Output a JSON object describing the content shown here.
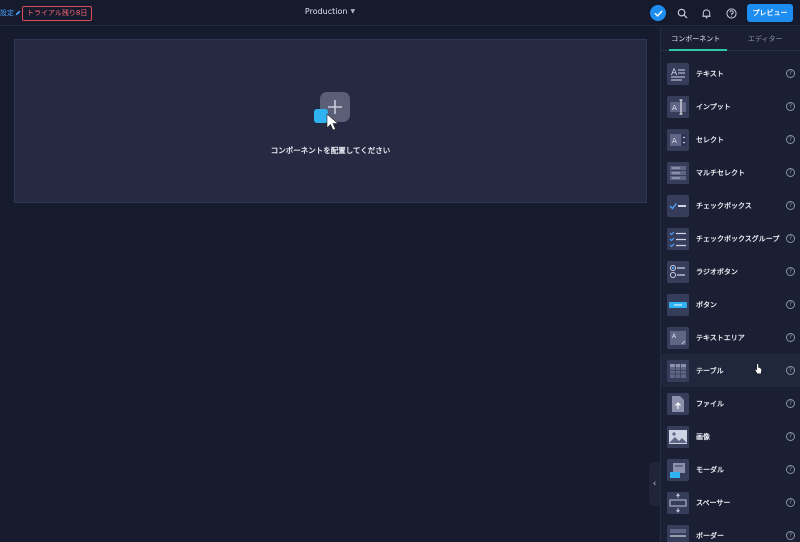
{
  "topbar": {
    "settings_label": "設定",
    "trial_badge": "トライアル残り8日",
    "environment": "Production",
    "preview_label": "プレビュー"
  },
  "canvas": {
    "dropzone_label": "コンポーネントを配置してください"
  },
  "panel": {
    "tabs": [
      {
        "label": "コンポーネント",
        "active": true
      },
      {
        "label": "エディター",
        "active": false
      }
    ],
    "items": [
      {
        "label": "テキスト",
        "icon": "text-icon"
      },
      {
        "label": "インプット",
        "icon": "input-icon"
      },
      {
        "label": "セレクト",
        "icon": "select-icon"
      },
      {
        "label": "マルチセレクト",
        "icon": "multiselect-icon"
      },
      {
        "label": "チェックボックス",
        "icon": "checkbox-icon"
      },
      {
        "label": "チェックボックスグループ",
        "icon": "checkbox-group-icon"
      },
      {
        "label": "ラジオボタン",
        "icon": "radio-icon"
      },
      {
        "label": "ボタン",
        "icon": "button-icon"
      },
      {
        "label": "テキストエリア",
        "icon": "textarea-icon"
      },
      {
        "label": "テーブル",
        "icon": "table-icon"
      },
      {
        "label": "ファイル",
        "icon": "file-icon"
      },
      {
        "label": "画像",
        "icon": "image-icon"
      },
      {
        "label": "モーダル",
        "icon": "modal-icon"
      },
      {
        "label": "スペーサー",
        "icon": "spacer-icon"
      },
      {
        "label": "ボーダー",
        "icon": "border-icon"
      }
    ],
    "help_glyph": "?"
  },
  "colors": {
    "accent": "#1e8df2",
    "tab_underline": "#2ec7a6",
    "trial": "#e04b5a",
    "background": "#161b2e",
    "panel": "#1a1f33"
  }
}
